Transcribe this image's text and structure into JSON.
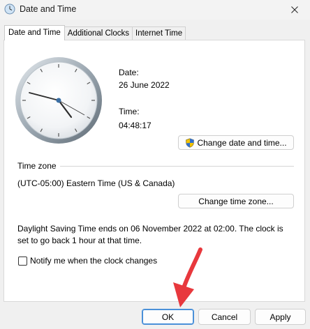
{
  "window": {
    "title": "Date and Time"
  },
  "tabs": [
    {
      "label": "Date and Time",
      "active": true
    },
    {
      "label": "Additional Clocks",
      "active": false
    },
    {
      "label": "Internet Time",
      "active": false
    }
  ],
  "date_time": {
    "date_label": "Date:",
    "date_value": "26 June 2022",
    "time_label": "Time:",
    "time_value": "04:48:17",
    "change_button": "Change date and time..."
  },
  "time_zone": {
    "section_label": "Time zone",
    "value": "(UTC-05:00) Eastern Time (US & Canada)",
    "change_button": "Change time zone..."
  },
  "dst_message": "Daylight Saving Time ends on 06 November 2022 at 02:00. The clock is set to go back 1 hour at that time.",
  "notify": {
    "label": "Notify me when the clock changes",
    "checked": false
  },
  "footer": {
    "ok": "OK",
    "cancel": "Cancel",
    "apply": "Apply"
  },
  "colors": {
    "accent": "#4a90d9",
    "arrow": "#e8383d"
  }
}
